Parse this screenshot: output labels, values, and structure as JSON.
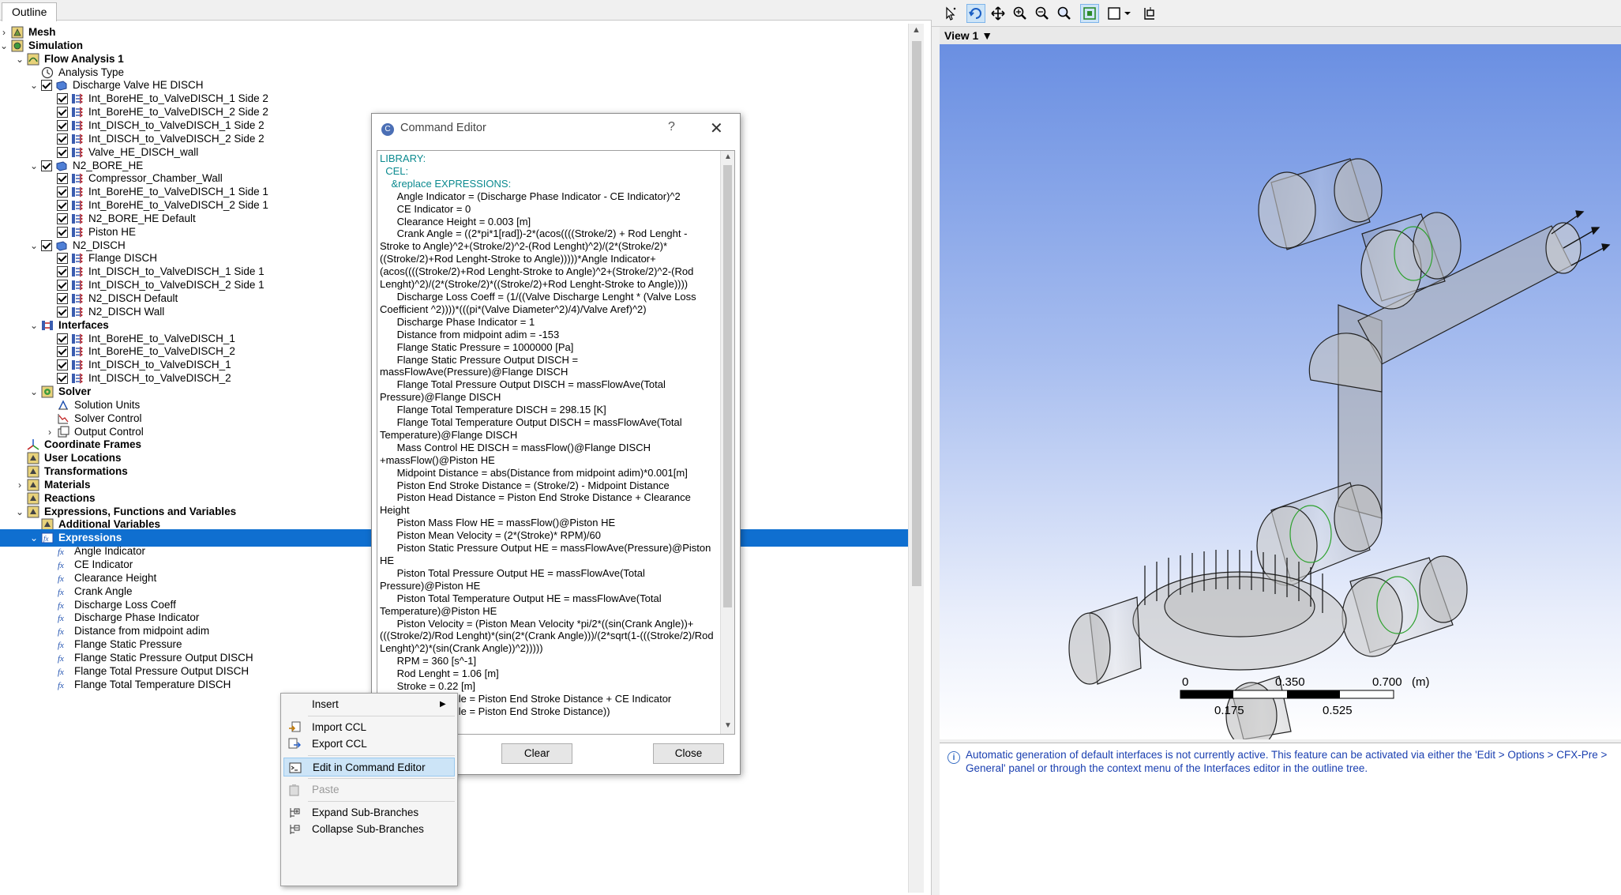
{
  "outline": {
    "tab_label": "Outline",
    "tree": [
      {
        "label": "Mesh",
        "level": 0,
        "expander": "right",
        "checkbox": false,
        "icon": "mesh-icon",
        "bold": true
      },
      {
        "label": "Simulation",
        "level": 0,
        "expander": "down",
        "checkbox": false,
        "icon": "simulation-icon",
        "bold": true
      },
      {
        "label": "Flow Analysis 1",
        "level": 1,
        "expander": "down",
        "checkbox": false,
        "icon": "flow-analysis-icon",
        "bold": true
      },
      {
        "label": "Analysis Type",
        "level": 2,
        "expander": "",
        "checkbox": false,
        "icon": "clock-icon",
        "bold": false
      },
      {
        "label": "Discharge Valve HE DISCH",
        "level": 2,
        "expander": "down",
        "checkbox": true,
        "icon": "domain-icon",
        "bold": false
      },
      {
        "label": "Int_BoreHE_to_ValveDISCH_1 Side 2",
        "level": 3,
        "expander": "",
        "checkbox": true,
        "icon": "boundary-icon",
        "bold": false
      },
      {
        "label": "Int_BoreHE_to_ValveDISCH_2 Side 2",
        "level": 3,
        "expander": "",
        "checkbox": true,
        "icon": "boundary-icon",
        "bold": false
      },
      {
        "label": "Int_DISCH_to_ValveDISCH_1 Side 2",
        "level": 3,
        "expander": "",
        "checkbox": true,
        "icon": "boundary-icon",
        "bold": false
      },
      {
        "label": "Int_DISCH_to_ValveDISCH_2 Side 2",
        "level": 3,
        "expander": "",
        "checkbox": true,
        "icon": "boundary-icon",
        "bold": false
      },
      {
        "label": "Valve_HE_DISCH_wall",
        "level": 3,
        "expander": "",
        "checkbox": true,
        "icon": "boundary-icon",
        "bold": false
      },
      {
        "label": "N2_BORE_HE",
        "level": 2,
        "expander": "down",
        "checkbox": true,
        "icon": "domain-icon",
        "bold": false
      },
      {
        "label": "Compressor_Chamber_Wall",
        "level": 3,
        "expander": "",
        "checkbox": true,
        "icon": "boundary-icon",
        "bold": false
      },
      {
        "label": "Int_BoreHE_to_ValveDISCH_1 Side 1",
        "level": 3,
        "expander": "",
        "checkbox": true,
        "icon": "boundary-icon",
        "bold": false
      },
      {
        "label": "Int_BoreHE_to_ValveDISCH_2 Side 1",
        "level": 3,
        "expander": "",
        "checkbox": true,
        "icon": "boundary-icon",
        "bold": false
      },
      {
        "label": "N2_BORE_HE Default",
        "level": 3,
        "expander": "",
        "checkbox": true,
        "icon": "boundary-icon",
        "bold": false
      },
      {
        "label": "Piston HE",
        "level": 3,
        "expander": "",
        "checkbox": true,
        "icon": "boundary-icon",
        "bold": false
      },
      {
        "label": "N2_DISCH",
        "level": 2,
        "expander": "down",
        "checkbox": true,
        "icon": "domain-icon",
        "bold": false
      },
      {
        "label": "Flange DISCH",
        "level": 3,
        "expander": "",
        "checkbox": true,
        "icon": "boundary-icon",
        "bold": false
      },
      {
        "label": "Int_DISCH_to_ValveDISCH_1 Side 1",
        "level": 3,
        "expander": "",
        "checkbox": true,
        "icon": "boundary-icon",
        "bold": false
      },
      {
        "label": "Int_DISCH_to_ValveDISCH_2 Side 1",
        "level": 3,
        "expander": "",
        "checkbox": true,
        "icon": "boundary-icon",
        "bold": false
      },
      {
        "label": "N2_DISCH Default",
        "level": 3,
        "expander": "",
        "checkbox": true,
        "icon": "boundary-icon",
        "bold": false
      },
      {
        "label": "N2_DISCH Wall",
        "level": 3,
        "expander": "",
        "checkbox": true,
        "icon": "boundary-icon",
        "bold": false
      },
      {
        "label": "Interfaces",
        "level": 2,
        "expander": "down",
        "checkbox": false,
        "icon": "interfaces-icon",
        "bold": true
      },
      {
        "label": "Int_BoreHE_to_ValveDISCH_1",
        "level": 3,
        "expander": "",
        "checkbox": true,
        "icon": "boundary-icon",
        "bold": false
      },
      {
        "label": "Int_BoreHE_to_ValveDISCH_2",
        "level": 3,
        "expander": "",
        "checkbox": true,
        "icon": "boundary-icon",
        "bold": false
      },
      {
        "label": "Int_DISCH_to_ValveDISCH_1",
        "level": 3,
        "expander": "",
        "checkbox": true,
        "icon": "boundary-icon",
        "bold": false
      },
      {
        "label": "Int_DISCH_to_ValveDISCH_2",
        "level": 3,
        "expander": "",
        "checkbox": true,
        "icon": "boundary-icon",
        "bold": false
      },
      {
        "label": "Solver",
        "level": 2,
        "expander": "down",
        "checkbox": false,
        "icon": "solver-icon",
        "bold": true
      },
      {
        "label": "Solution Units",
        "level": 3,
        "expander": "",
        "checkbox": false,
        "icon": "units-icon",
        "bold": false
      },
      {
        "label": "Solver Control",
        "level": 3,
        "expander": "",
        "checkbox": false,
        "icon": "solver-control-icon",
        "bold": false
      },
      {
        "label": "Output Control",
        "level": 3,
        "expander": "right",
        "checkbox": false,
        "icon": "output-control-icon",
        "bold": false
      },
      {
        "label": "Coordinate Frames",
        "level": 1,
        "expander": "",
        "checkbox": false,
        "icon": "coordinate-frames-icon",
        "bold": true
      },
      {
        "label": "User Locations",
        "level": 1,
        "expander": "",
        "checkbox": false,
        "icon": "folder-icon",
        "bold": true
      },
      {
        "label": "Transformations",
        "level": 1,
        "expander": "",
        "checkbox": false,
        "icon": "folder-icon",
        "bold": true
      },
      {
        "label": "Materials",
        "level": 1,
        "expander": "right",
        "checkbox": false,
        "icon": "folder-icon",
        "bold": true
      },
      {
        "label": "Reactions",
        "level": 1,
        "expander": "",
        "checkbox": false,
        "icon": "folder-icon",
        "bold": true
      },
      {
        "label": "Expressions, Functions and Variables",
        "level": 1,
        "expander": "down",
        "checkbox": false,
        "icon": "folder-icon",
        "bold": true
      },
      {
        "label": "Additional Variables",
        "level": 2,
        "expander": "",
        "checkbox": false,
        "icon": "folder-icon",
        "bold": true
      },
      {
        "label": "Expressions",
        "level": 2,
        "expander": "down",
        "checkbox": false,
        "icon": "expressions-icon",
        "bold": true,
        "selected": true
      },
      {
        "label": "Angle Indicator",
        "level": 3,
        "expander": "",
        "checkbox": false,
        "icon": "expression-icon",
        "bold": false
      },
      {
        "label": "CE Indicator",
        "level": 3,
        "expander": "",
        "checkbox": false,
        "icon": "expression-icon",
        "bold": false
      },
      {
        "label": "Clearance Height",
        "level": 3,
        "expander": "",
        "checkbox": false,
        "icon": "expression-icon",
        "bold": false
      },
      {
        "label": "Crank Angle",
        "level": 3,
        "expander": "",
        "checkbox": false,
        "icon": "expression-icon",
        "bold": false
      },
      {
        "label": "Discharge Loss Coeff",
        "level": 3,
        "expander": "",
        "checkbox": false,
        "icon": "expression-icon",
        "bold": false
      },
      {
        "label": "Discharge Phase Indicator",
        "level": 3,
        "expander": "",
        "checkbox": false,
        "icon": "expression-icon",
        "bold": false
      },
      {
        "label": "Distance from midpoint adim",
        "level": 3,
        "expander": "",
        "checkbox": false,
        "icon": "expression-icon",
        "bold": false
      },
      {
        "label": "Flange Static Pressure",
        "level": 3,
        "expander": "",
        "checkbox": false,
        "icon": "expression-icon",
        "bold": false
      },
      {
        "label": "Flange Static Pressure Output DISCH",
        "level": 3,
        "expander": "",
        "checkbox": false,
        "icon": "expression-icon",
        "bold": false
      },
      {
        "label": "Flange Total Pressure Output DISCH",
        "level": 3,
        "expander": "",
        "checkbox": false,
        "icon": "expression-icon",
        "bold": false
      },
      {
        "label": "Flange Total Temperature DISCH",
        "level": 3,
        "expander": "",
        "checkbox": false,
        "icon": "expression-icon",
        "bold": false
      }
    ]
  },
  "viewer": {
    "view_title": "View 1",
    "toolbar_icons": [
      "select-icon",
      "rotate-icon",
      "pan-icon",
      "zoom-icon",
      "zoom-box-icon",
      "zoom-fit-icon",
      "fit-view-icon",
      "display-mode-icon",
      "new-viewer-icon"
    ],
    "scale": {
      "top_labels": [
        "0",
        "0.350",
        "0.700"
      ],
      "unit": "(m)",
      "bottom_labels": [
        "0.175",
        "0.525"
      ]
    },
    "message": "Automatic generation of default interfaces is not currently active. This feature can be activated via either the 'Edit > Options > CFX-Pre > General' panel or through the context menu of the Interfaces editor in the outline tree."
  },
  "command_editor": {
    "title": "Command Editor",
    "help_label": "?",
    "close_glyph": "✕",
    "header_lines": [
      "LIBRARY:",
      "  CEL:",
      "    &replace EXPRESSIONS:"
    ],
    "body_text": "      Angle Indicator = (Discharge Phase Indicator - CE Indicator)^2\n      CE Indicator = 0\n      Clearance Height = 0.003 [m]\n      Crank Angle = ((2*pi*1[rad])-2*(acos((((Stroke/2) + Rod Lenght - Stroke to Angle)^2+(Stroke/2)^2-(Rod Lenght)^2)/(2*(Stroke/2)*((Stroke/2)+Rod Lenght-Stroke to Angle)))))*Angle Indicator+(acos((((Stroke/2)+Rod Lenght-Stroke to Angle)^2+(Stroke/2)^2-(Rod Lenght)^2)/(2*(Stroke/2)*((Stroke/2)+Rod Lenght-Stroke to Angle))))\n      Discharge Loss Coeff = (1/((Valve Discharge Lenght * (Valve Loss Coefficient ^2))))*(((pi*(Valve Diameter^2)/4)/Valve Aref)^2)\n      Discharge Phase Indicator = 1\n      Distance from midpoint adim = -153\n      Flange Static Pressure = 1000000 [Pa]\n      Flange Static Pressure Output DISCH = massFlowAve(Pressure)@Flange DISCH\n      Flange Total Pressure Output DISCH = massFlowAve(Total Pressure)@Flange DISCH\n      Flange Total Temperature DISCH = 298.15 [K]\n      Flange Total Temperature Output DISCH = massFlowAve(Total Temperature)@Flange DISCH\n      Mass Control HE DISCH = massFlow()@Flange DISCH +massFlow()@Piston HE\n      Midpoint Distance = abs(Distance from midpoint adim)*0.001[m]\n      Piston End Stroke Distance = (Stroke/2) - Midpoint Distance\n      Piston Head Distance = Piston End Stroke Distance + Clearance Height\n      Piston Mass Flow HE = massFlow()@Piston HE\n      Piston Mean Velocity = (2*(Stroke)* RPM)/60\n      Piston Static Pressure Output HE = massFlowAve(Pressure)@Piston HE\n      Piston Total Pressure Output HE = massFlowAve(Total Pressure)@Piston HE\n      Piston Total Temperature Output HE = massFlowAve(Total Temperature)@Piston HE\n      Piston Velocity = (Piston Mean Velocity *pi/2*((sin(Crank Angle))+(((Stroke/2)/Rod Lenght)*(sin(2*(Crank Angle)))/(2*sqrt(1-(((Stroke/2)/Rod Lenght)^2)*(sin(Crank Angle))^2)))))\n      RPM = 360 [s^-1]\n      Rod Lenght = 1.06 [m]\n      Stroke = 0.22 [m]\n      Stroke to Angle = Piston End Stroke Distance + CE Indicator\n      Stroke to Angle = Piston End Stroke Distance))",
    "clear_label": "Clear",
    "close_label": "Close"
  },
  "context_menu": {
    "items": [
      {
        "label": "Insert",
        "icon": "",
        "submenu": true,
        "disabled": false,
        "highlighted": false
      },
      {
        "label": "Import CCL",
        "icon": "import-ccl-icon",
        "submenu": false,
        "disabled": false,
        "highlighted": false
      },
      {
        "label": "Export CCL",
        "icon": "export-ccl-icon",
        "submenu": false,
        "disabled": false,
        "highlighted": false
      },
      {
        "label": "Edit in Command Editor",
        "icon": "command-editor-icon",
        "submenu": false,
        "disabled": false,
        "highlighted": true
      },
      {
        "label": "Paste",
        "icon": "paste-icon",
        "submenu": false,
        "disabled": true,
        "highlighted": false
      },
      {
        "label": "Expand Sub-Branches",
        "icon": "expand-branches-icon",
        "submenu": false,
        "disabled": false,
        "highlighted": false
      },
      {
        "label": "Collapse Sub-Branches",
        "icon": "collapse-branches-icon",
        "submenu": false,
        "disabled": false,
        "highlighted": false
      }
    ]
  }
}
